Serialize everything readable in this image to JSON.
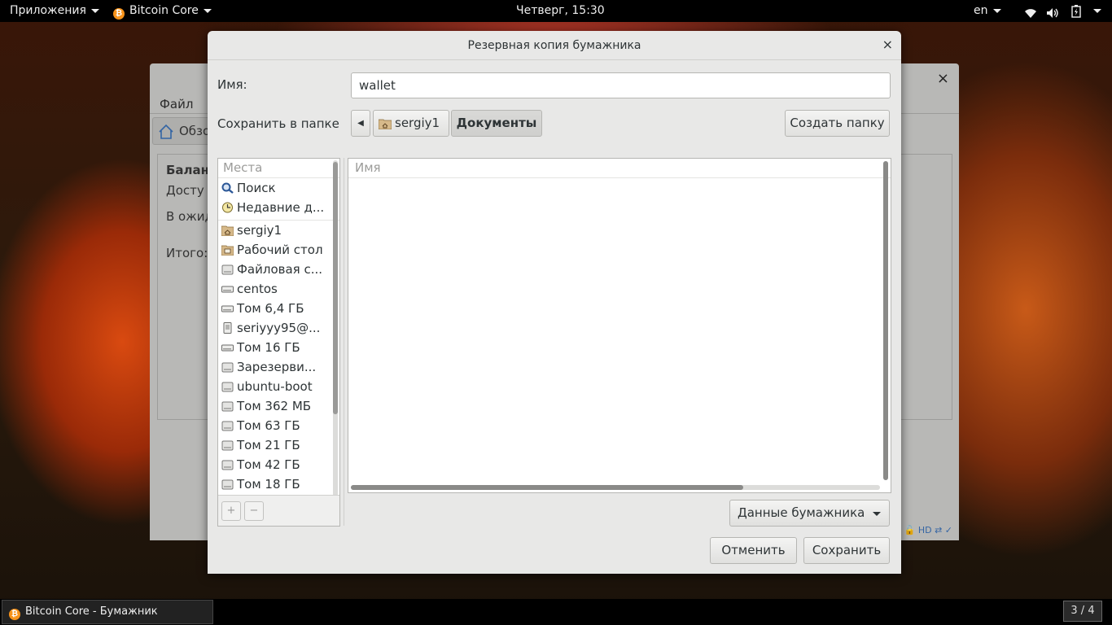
{
  "topbar": {
    "apps_label": "Приложения",
    "app_name": "Bitcoin Core",
    "clock": "Четверг, 15:30",
    "lang": "en"
  },
  "background_window": {
    "menu_file": "Файл",
    "overview_tab": "Обзо",
    "balance_heading": "Балан",
    "available": "Досту",
    "pending": "В ожид",
    "total": "Итого:",
    "status_hd": "HD"
  },
  "dialog": {
    "title": "Резервная копия бумажника",
    "close": "×",
    "name_label": "Имя:",
    "name_value": "wallet",
    "folder_label": "Сохранить в папке",
    "path_back": "◀",
    "path": [
      {
        "label": "sergiy1",
        "icon": "home-folder-icon"
      },
      {
        "label": "Документы"
      }
    ],
    "create_folder": "Создать папку",
    "places_header": "Места",
    "places_group1": [
      {
        "label": "Поиск",
        "icon": "search-icon"
      },
      {
        "label": "Недавние д...",
        "icon": "recent-icon"
      }
    ],
    "places_group2": [
      {
        "label": "sergiy1",
        "icon": "home-folder-icon"
      },
      {
        "label": "Рабочий стол",
        "icon": "desktop-folder-icon"
      },
      {
        "label": "Файловая с...",
        "icon": "drive-icon"
      },
      {
        "label": "centos",
        "icon": "disk-icon"
      },
      {
        "label": "Том 6,4 ГБ",
        "icon": "disk-icon"
      },
      {
        "label": "seriyyy95@...",
        "icon": "network-drive-icon"
      },
      {
        "label": "Том 16 ГБ",
        "icon": "disk-icon"
      },
      {
        "label": "Зарезерви...",
        "icon": "drive-icon"
      },
      {
        "label": "ubuntu-boot",
        "icon": "drive-icon"
      },
      {
        "label": "Том 362 МБ",
        "icon": "drive-icon"
      },
      {
        "label": "Том 63 ГБ",
        "icon": "drive-icon"
      },
      {
        "label": "Том 21 ГБ",
        "icon": "drive-icon"
      },
      {
        "label": "Том 42 ГБ",
        "icon": "drive-icon"
      },
      {
        "label": "Том 18 ГБ",
        "icon": "drive-icon"
      }
    ],
    "add_place": "+",
    "remove_place": "−",
    "files_header": "Имя",
    "filter_value": "Данные бумажника",
    "cancel": "Отменить",
    "save": "Сохранить"
  },
  "taskbar": {
    "task_label": "Bitcoin Core - Бумажник",
    "workspace": "3 / 4"
  }
}
